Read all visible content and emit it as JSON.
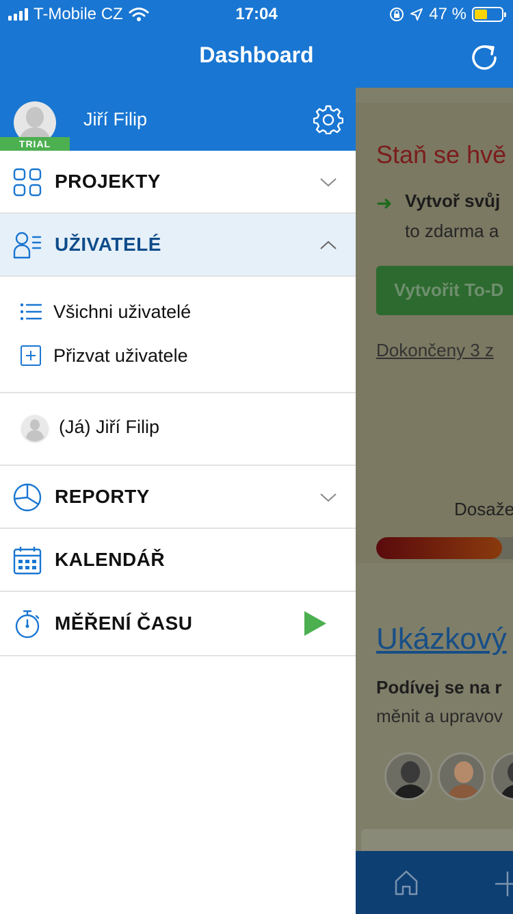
{
  "status_bar": {
    "carrier": "T-Mobile CZ",
    "time": "17:04",
    "battery": "47 %",
    "battery_level": 0.47
  },
  "header": {
    "title": "Dashboard",
    "refresh_icon": "refresh-icon"
  },
  "drawer": {
    "profile": {
      "name": "Jiří Filip",
      "badge": "TRIAL",
      "settings_icon": "gear-icon"
    },
    "projects": {
      "label": "PROJEKTY",
      "icon": "grid-icon",
      "expanded": false
    },
    "users": {
      "label": "UŽIVATELÉ",
      "icon": "users-icon",
      "expanded": true,
      "items": [
        {
          "label": "Všichni uživatelé",
          "icon": "list-icon"
        },
        {
          "label": "Přizvat uživatele",
          "icon": "plus-square-icon"
        }
      ],
      "me": "(Já) Jiří Filip"
    },
    "reports": {
      "label": "REPORTY",
      "icon": "pie-chart-icon",
      "expanded": false
    },
    "calendar": {
      "label": "KALENDÁŘ",
      "icon": "calendar-icon"
    },
    "time_tracking": {
      "label": "MĚŘENÍ ČASU",
      "icon": "stopwatch-icon",
      "action_icon": "play-icon"
    },
    "colors": {
      "accent": "#1976d2",
      "active_bg": "#e6f0f9",
      "active_text": "#0f4c8a",
      "trial": "#4caf50",
      "play": "#4caf50"
    }
  },
  "background": {
    "card1": {
      "title": "Staň se hvě",
      "bold": "Vytvoř svůj",
      "sub": "to zdarma a",
      "button": "Vytvořit To-D",
      "link": "Dokončeny 3 z",
      "progress_label": "Dosaže",
      "progress": 0.8
    },
    "card2": {
      "title": "Ukázkový",
      "bold": "Podívej se na r",
      "sub": "měnit a upravov"
    }
  }
}
